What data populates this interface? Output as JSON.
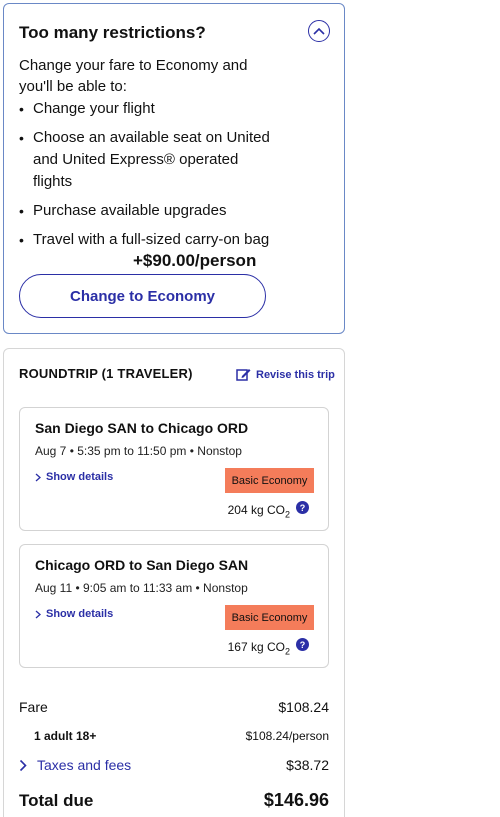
{
  "restrictions": {
    "title": "Too many restrictions?",
    "intro": "Change your fare to Economy and you'll be able to:",
    "benefits": [
      "Change your flight",
      "Choose an available seat on United and United Express® operated flights",
      "Purchase available upgrades",
      "Travel with a full-sized carry-on bag"
    ],
    "price_add": "+$90.00/person",
    "change_button": "Change to Economy",
    "collapse_icon": "chevron-up-icon"
  },
  "trip": {
    "header": "ROUNDTRIP (1 TRAVELER)",
    "revise_label": "Revise this trip",
    "segments": [
      {
        "route": "San Diego SAN to Chicago ORD",
        "time": "Aug 7 • 5:35 pm to 11:50 pm • Nonstop",
        "details_label": "Show details",
        "fare_class": "Basic Economy",
        "co2_value": "204 kg CO",
        "co2_sub": "2"
      },
      {
        "route": "Chicago ORD to San Diego SAN",
        "time": "Aug 11 • 9:05 am to 11:33 am • Nonstop",
        "details_label": "Show details",
        "fare_class": "Basic Economy",
        "co2_value": "167 kg CO",
        "co2_sub": "2"
      }
    ],
    "pricing": {
      "fare_label": "Fare",
      "fare_value": "$108.24",
      "adult_label": "1 adult 18+",
      "adult_value": "$108.24/person",
      "taxes_label": "Taxes and fees",
      "taxes_value": "$38.72",
      "total_label": "Total due",
      "total_value": "$146.96"
    }
  },
  "colors": {
    "brand": "#2b2fa6",
    "badge": "#f47c5a",
    "card_border": "#6a88c6"
  }
}
